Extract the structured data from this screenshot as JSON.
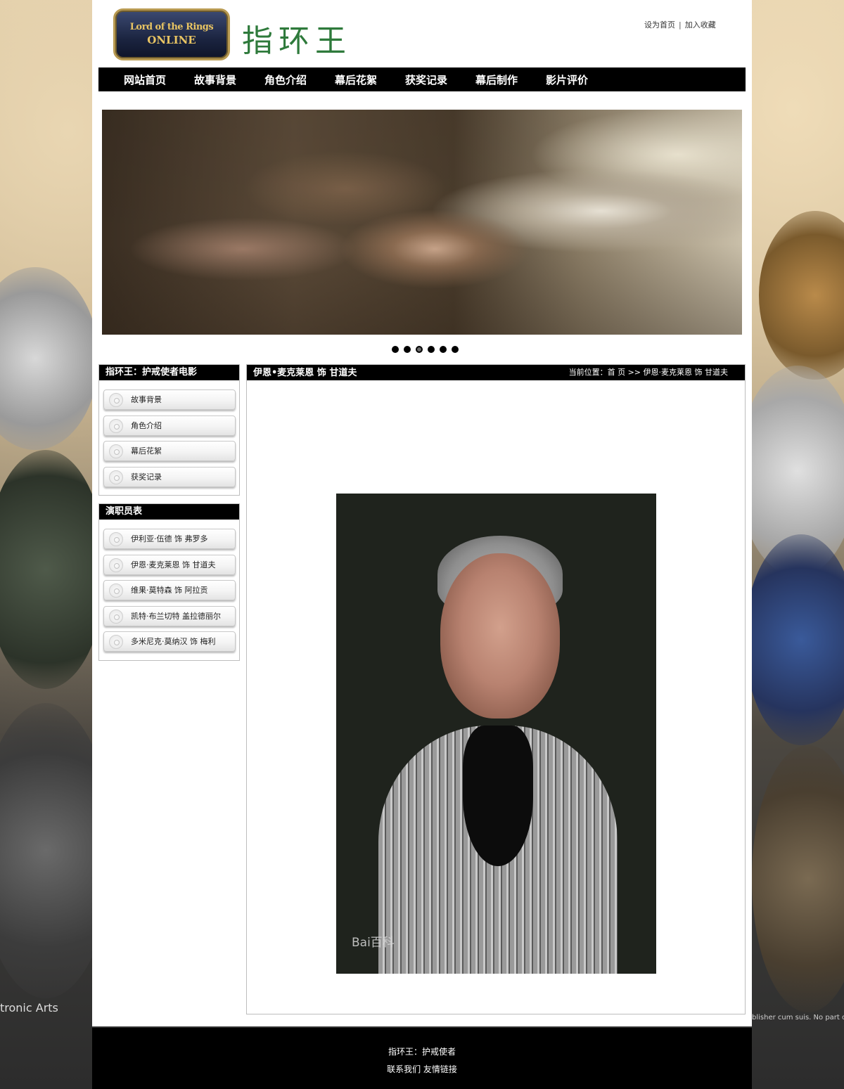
{
  "header": {
    "logo": {
      "line1": "Lord of the Rings",
      "line2": "ONLINE"
    },
    "site_title": "指环王",
    "toplinks": {
      "set_home": "设为首页",
      "separator": "|",
      "add_favorite": "加入收藏"
    }
  },
  "nav": {
    "items": [
      "网站首页",
      "故事背景",
      "角色介绍",
      "幕后花絮",
      "获奖记录",
      "幕后制作",
      "影片评价"
    ]
  },
  "carousel": {
    "dot_count": 6,
    "active_index": 2
  },
  "sidebar": {
    "box1": {
      "title": "指环王：护戒使者电影",
      "items": [
        "故事背景",
        "角色介绍",
        "幕后花絮",
        "获奖记录"
      ]
    },
    "box2": {
      "title": "演职员表",
      "items": [
        "伊利亚·伍德 饰 弗罗多",
        "伊恩·麦克莱恩 饰 甘道夫",
        "维果·莫特森 饰 阿拉贡",
        "凯特·布兰切特 盖拉德丽尔",
        "多米尼克·莫纳汉 饰 梅利"
      ]
    }
  },
  "content": {
    "title": "伊恩•麦克莱恩 饰 甘道夫",
    "breadcrumb": "当前位置：首 页 >> 伊恩·麦克莱恩 饰 甘道夫",
    "photo_watermark": "Bai百科"
  },
  "side_art": {
    "left_text": "tronic Arts",
    "right_text": "blisher cum suis. No part of this"
  },
  "footer": {
    "line1": "指环王：护戒使者",
    "line2": "联系我们 友情链接"
  },
  "colors": {
    "title_green": "#2e7a3b",
    "nav_bg": "#000000",
    "footer_bg": "#000000"
  }
}
